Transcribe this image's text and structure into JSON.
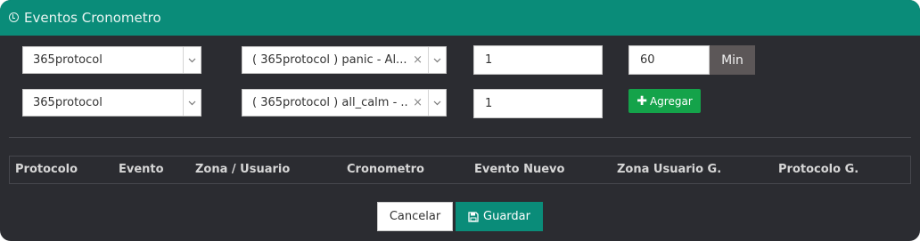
{
  "header": {
    "title": "Eventos Cronometro",
    "icon": "clock-icon"
  },
  "rows": [
    {
      "protocol": "365protocol",
      "event": "( 365protocol ) panic - Al...",
      "quantity": "1"
    },
    {
      "protocol": "365protocol",
      "event": "( 365protocol ) all_calm - ...",
      "quantity": "1"
    }
  ],
  "timer": {
    "value": "60",
    "unit": "Min"
  },
  "add_button": {
    "label": "Agregar",
    "icon": "plus-icon"
  },
  "table": {
    "columns": [
      "Protocolo",
      "Evento",
      "Zona / Usuario",
      "Cronometro",
      "Evento Nuevo",
      "Zona Usuario G.",
      "Protocolo G."
    ]
  },
  "footer": {
    "cancel_label": "Cancelar",
    "save_label": "Guardar",
    "save_icon": "floppy-disk-icon"
  },
  "colors": {
    "header": "#0a8c79",
    "body": "#2b2c31",
    "add_button": "#14a34a",
    "save_button": "#0a8c79",
    "unit_addon": "#5c5758"
  }
}
